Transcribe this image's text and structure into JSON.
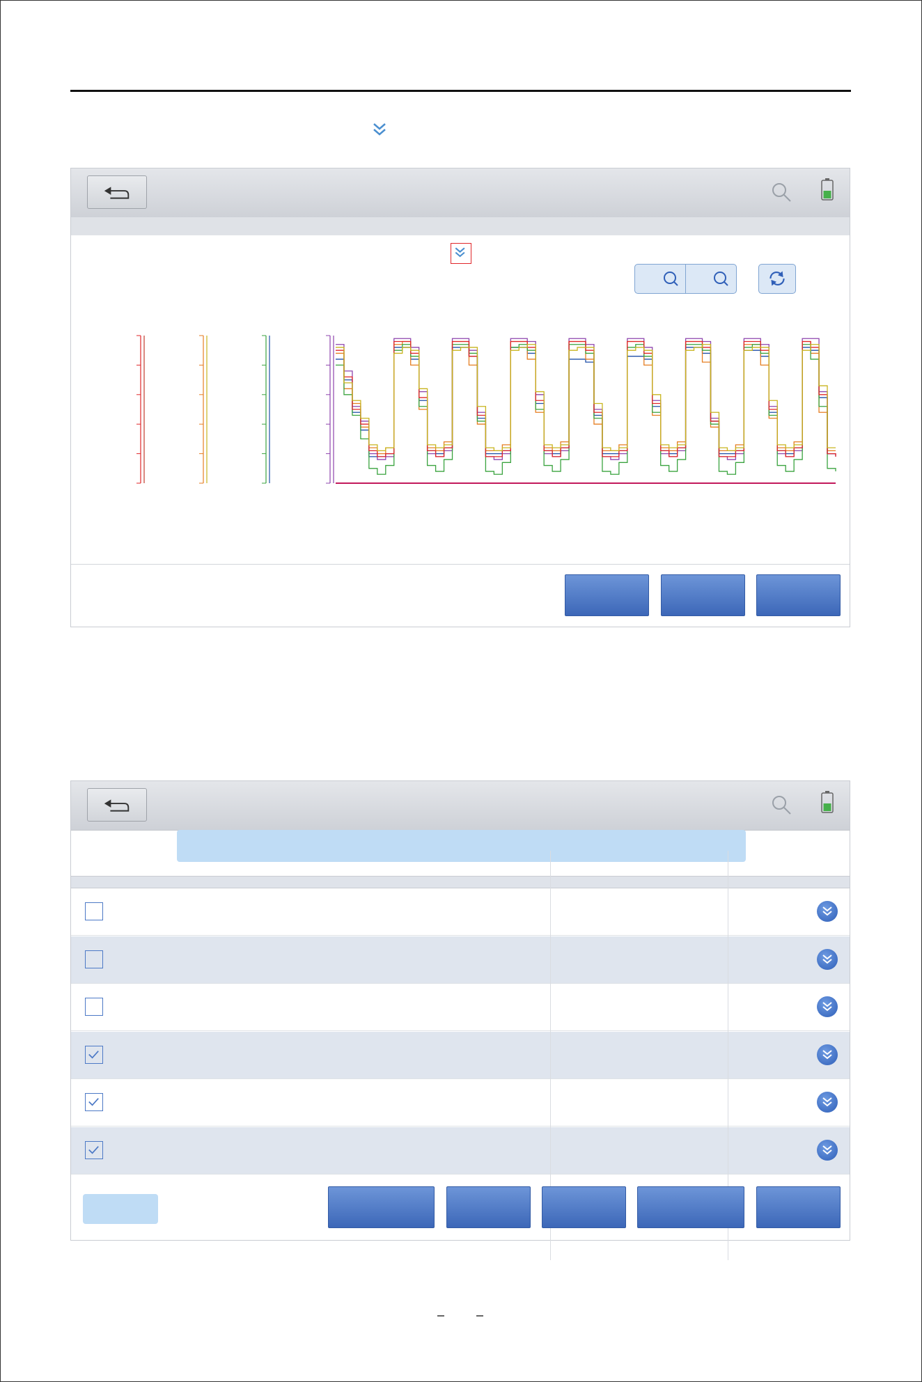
{
  "colors": {
    "accent": "#3c67b8",
    "titlebar": "#d6d9de",
    "alt_row": "#dfe5ee",
    "highlight": "#bfdcf5",
    "chevron": "#4a8fd0",
    "battery_fill": "#46b04a"
  },
  "icons": [
    "back-arrow-icon",
    "search-icon",
    "battery-icon",
    "chevron-double-down-icon",
    "zoom-in-icon",
    "zoom-out-icon",
    "refresh-icon",
    "checkmark-icon"
  ],
  "screen1": {
    "buttons": [
      "",
      "",
      ""
    ]
  },
  "screen2": {
    "rows": [
      {
        "checked": false
      },
      {
        "checked": false
      },
      {
        "checked": false
      },
      {
        "checked": true
      },
      {
        "checked": true
      },
      {
        "checked": true
      }
    ],
    "buttons": [
      "",
      "",
      "",
      "",
      ""
    ]
  },
  "chart_data": {
    "type": "line",
    "title": "",
    "xlabel": "",
    "ylabel": "",
    "x": [
      0,
      1,
      2,
      3,
      4,
      5,
      6,
      7,
      8,
      9,
      10,
      11,
      12,
      13,
      14,
      15,
      16,
      17,
      18,
      19,
      20,
      21,
      22,
      23,
      24,
      25,
      26,
      27,
      28,
      29,
      30,
      31,
      32,
      33,
      34,
      35,
      36,
      37,
      38,
      39,
      40,
      41,
      42,
      43,
      44,
      45,
      46,
      47,
      48,
      49,
      50,
      51,
      52,
      53,
      54,
      55,
      56,
      57,
      58,
      59,
      60
    ],
    "ylim": [
      0,
      5
    ],
    "series": [
      {
        "color": "#8e44ad",
        "values": [
          4.7,
          3.8,
          2.6,
          2.1,
          1.0,
          0.8,
          0.9,
          4.9,
          4.9,
          4.6,
          3.1,
          1.0,
          0.9,
          1.1,
          4.9,
          4.9,
          4.5,
          2.4,
          0.9,
          0.8,
          1.0,
          4.9,
          4.9,
          4.8,
          3.0,
          1.0,
          0.9,
          1.1,
          4.9,
          4.9,
          4.7,
          2.5,
          0.9,
          0.8,
          1.0,
          4.9,
          4.9,
          4.6,
          2.8,
          1.0,
          0.9,
          1.1,
          4.9,
          4.9,
          4.8,
          2.2,
          0.9,
          0.8,
          1.0,
          4.9,
          4.9,
          4.7,
          2.6,
          1.0,
          0.9,
          1.1,
          4.9,
          4.9,
          3.1,
          1.0,
          0.9
        ]
      },
      {
        "color": "#1f4fa8",
        "values": [
          4.2,
          3.5,
          2.4,
          1.8,
          0.9,
          0.9,
          1.0,
          4.6,
          4.6,
          4.2,
          2.8,
          1.1,
          1.0,
          1.2,
          4.6,
          4.6,
          4.3,
          2.2,
          1.0,
          1.0,
          1.1,
          4.6,
          4.6,
          4.4,
          2.7,
          1.1,
          1.0,
          1.2,
          4.2,
          4.2,
          4.1,
          2.3,
          1.0,
          1.0,
          1.1,
          4.3,
          4.3,
          4.2,
          2.6,
          1.1,
          1.0,
          1.2,
          4.6,
          4.6,
          4.4,
          2.1,
          1.0,
          1.0,
          1.1,
          4.5,
          4.5,
          4.3,
          2.4,
          1.1,
          1.0,
          1.2,
          4.6,
          4.5,
          2.9,
          1.0,
          1.0
        ]
      },
      {
        "color": "#e67e22",
        "values": [
          4.4,
          3.2,
          2.7,
          1.9,
          1.2,
          1.0,
          1.2,
          4.7,
          4.8,
          4.0,
          2.5,
          1.2,
          1.1,
          1.4,
          4.8,
          4.8,
          4.0,
          2.0,
          1.1,
          1.1,
          1.3,
          4.8,
          4.8,
          4.2,
          2.4,
          1.2,
          1.1,
          1.4,
          4.8,
          4.8,
          4.2,
          2.0,
          1.1,
          1.1,
          1.3,
          4.8,
          4.8,
          4.0,
          2.3,
          1.2,
          1.1,
          1.4,
          4.8,
          4.8,
          4.1,
          1.9,
          1.1,
          1.1,
          1.3,
          4.7,
          4.7,
          4.0,
          2.2,
          1.2,
          1.1,
          1.4,
          4.8,
          4.4,
          2.4,
          1.1,
          1.1
        ]
      },
      {
        "color": "#3aa33f",
        "values": [
          4.0,
          3.0,
          2.3,
          1.5,
          0.5,
          0.3,
          0.6,
          4.5,
          4.7,
          4.3,
          2.6,
          0.6,
          0.4,
          0.8,
          4.7,
          4.7,
          4.4,
          2.1,
          0.4,
          0.3,
          0.7,
          4.6,
          4.7,
          4.5,
          2.5,
          0.6,
          0.4,
          0.8,
          4.7,
          4.7,
          4.4,
          2.2,
          0.4,
          0.3,
          0.7,
          4.6,
          4.7,
          4.3,
          2.4,
          0.6,
          0.4,
          0.8,
          4.7,
          4.7,
          4.5,
          2.0,
          0.4,
          0.3,
          0.7,
          4.6,
          4.7,
          4.4,
          2.3,
          0.6,
          0.4,
          0.8,
          4.7,
          4.2,
          2.6,
          0.5,
          0.4
        ]
      },
      {
        "color": "#e0262a",
        "values": [
          4.5,
          3.6,
          2.5,
          2.0,
          1.1,
          0.9,
          1.0,
          4.8,
          4.8,
          4.4,
          2.9,
          1.1,
          0.9,
          1.2,
          4.8,
          4.8,
          4.3,
          2.3,
          0.9,
          0.9,
          1.1,
          4.8,
          4.8,
          4.6,
          2.8,
          1.1,
          0.9,
          1.2,
          4.8,
          4.8,
          4.5,
          2.4,
          0.9,
          0.9,
          1.1,
          4.8,
          4.8,
          4.4,
          2.7,
          1.1,
          0.9,
          1.2,
          4.8,
          4.8,
          4.6,
          2.1,
          0.9,
          0.9,
          1.1,
          4.8,
          4.8,
          4.5,
          2.5,
          1.1,
          0.9,
          1.2,
          4.8,
          4.6,
          3.0,
          1.0,
          0.9
        ]
      },
      {
        "color": "#c8b41e",
        "values": [
          4.6,
          3.4,
          2.8,
          2.2,
          1.3,
          1.1,
          1.2,
          4.4,
          4.6,
          4.5,
          3.2,
          1.3,
          1.2,
          1.3,
          4.5,
          4.6,
          4.6,
          2.6,
          1.2,
          1.1,
          1.2,
          4.5,
          4.6,
          4.7,
          3.1,
          1.3,
          1.2,
          1.3,
          4.5,
          4.6,
          4.6,
          2.7,
          1.2,
          1.1,
          1.2,
          4.5,
          4.6,
          4.5,
          3.0,
          1.3,
          1.2,
          1.3,
          4.5,
          4.6,
          4.7,
          2.4,
          1.2,
          1.1,
          1.2,
          4.5,
          4.6,
          4.6,
          2.8,
          1.3,
          1.2,
          1.3,
          4.5,
          4.7,
          3.3,
          1.2,
          1.2
        ]
      }
    ]
  }
}
